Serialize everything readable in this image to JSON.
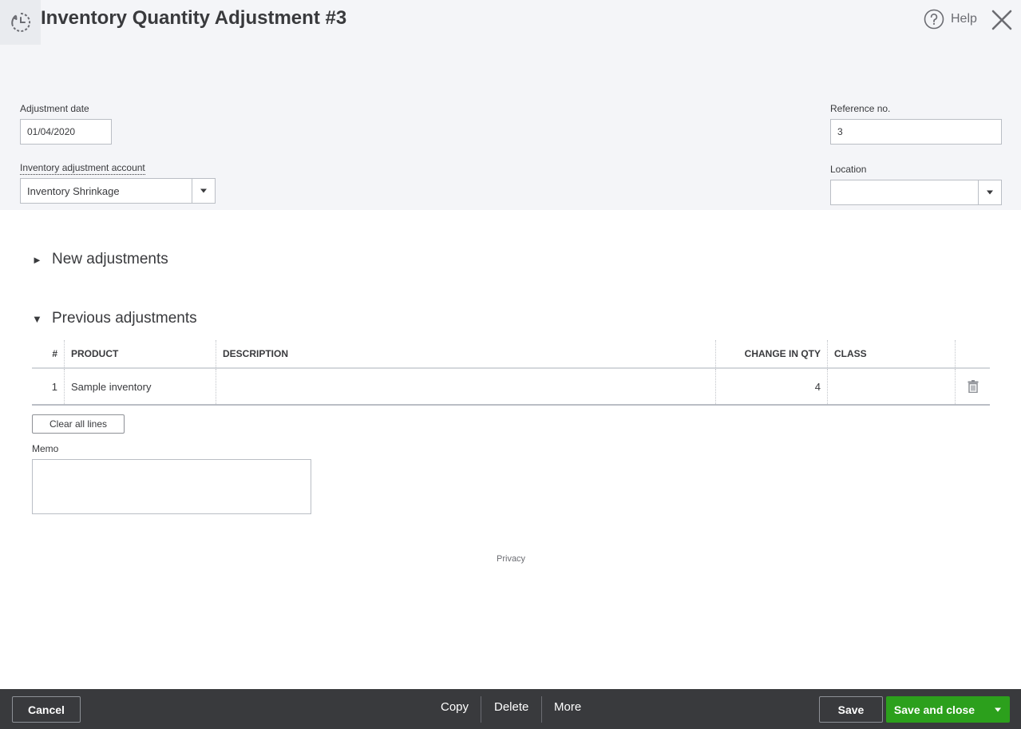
{
  "header": {
    "title": "Inventory Quantity Adjustment #3",
    "help_label": "Help",
    "history_icon": "history-clock-icon",
    "help_icon": "question-circle-icon",
    "close_icon": "close-icon"
  },
  "form": {
    "adjustment_date_label": "Adjustment date",
    "adjustment_date_value": "01/04/2020",
    "account_label": "Inventory adjustment account",
    "account_value": "Inventory Shrinkage",
    "reference_label": "Reference no.",
    "reference_value": "3",
    "location_label": "Location",
    "location_value": ""
  },
  "sections": {
    "new_label": "New adjustments",
    "new_collapsed_arrow": "►",
    "previous_label": "Previous adjustments",
    "previous_expanded_arrow": "▼"
  },
  "table": {
    "columns": [
      "#",
      "PRODUCT",
      "DESCRIPTION",
      "CHANGE IN QTY",
      "CLASS"
    ],
    "rows": [
      {
        "num": "1",
        "product": "Sample inventory",
        "description": "",
        "change_qty": "4",
        "class": ""
      }
    ]
  },
  "clear_all_label": "Clear all lines",
  "memo_label": "Memo",
  "memo_value": "",
  "privacy_label": "Privacy",
  "footer": {
    "cancel": "Cancel",
    "copy": "Copy",
    "delete": "Delete",
    "more": "More",
    "save": "Save",
    "save_and_close": "Save and close"
  },
  "colors": {
    "header_bg": "#f4f5f8",
    "footer_bg": "#393a3d",
    "primary_green": "#2ca01c",
    "text": "#393a3d"
  }
}
